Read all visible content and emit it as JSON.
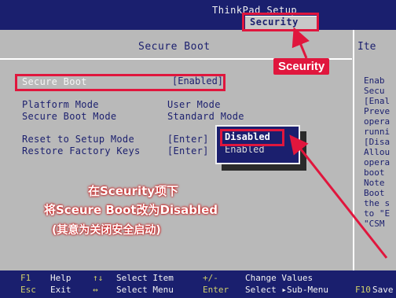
{
  "app_title": "ThinkPad Setup",
  "tab": {
    "label": "Security"
  },
  "section_title": "Secure Boot",
  "help_header": "Ite",
  "settings": {
    "secure_boot": {
      "label": "Secure Boot",
      "value": "[Enabled]"
    },
    "platform_mode": {
      "label": "Platform Mode",
      "value": "User Mode"
    },
    "secure_boot_mode": {
      "label": "Secure Boot Mode",
      "value": "Standard Mode"
    },
    "reset_setup_mode": {
      "label": "Reset to Setup Mode",
      "value": "[Enter]"
    },
    "restore_factory_keys": {
      "label": "Restore Factory Keys",
      "value": "[Enter]"
    }
  },
  "popup": {
    "selected": "Disabled",
    "other": "Enabled"
  },
  "help_lines": [
    "Enab",
    "Secu",
    "[Enal",
    "Preve",
    "opera",
    "runni",
    "[Disa",
    "Allou",
    "opera",
    "boot",
    "Note",
    "Boot",
    "the s",
    "to \"E",
    "\"CSM"
  ],
  "annotations": {
    "label": "Sceurity",
    "line1": "在Sceurity项下",
    "line2": "将Sceure Boot改为Disabled",
    "line3": "(其意为关闭安全启动)"
  },
  "footer": {
    "f1_key": "F1",
    "f1_label": "Help",
    "esc_key": "Esc",
    "esc_label": "Exit",
    "updown_key": "↑↓",
    "updown_label": "Select Item",
    "leftright_key": "↔",
    "leftright_label": "Select Menu",
    "plusminus_key": "+/-",
    "plusminus_label": "Change Values",
    "enter_key": "Enter",
    "enter_label": "Select ▸Sub-Menu",
    "f10_key": "F10",
    "f10_label": "Save"
  },
  "colors": {
    "bios_blue": "#1b1f6e",
    "panel_gray": "#b9b9b9",
    "annotation_red": "#e0163d"
  }
}
